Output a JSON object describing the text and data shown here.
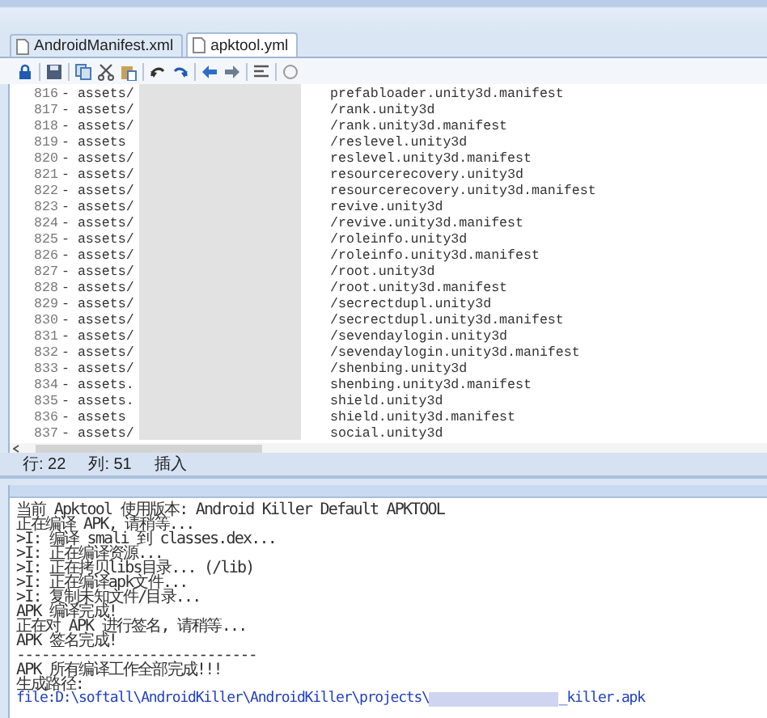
{
  "tabs": [
    {
      "label": "AndroidManifest.xml",
      "selected": false
    },
    {
      "label": "apktool.yml",
      "selected": true
    }
  ],
  "editor": {
    "lines": [
      {
        "number": "816",
        "prefix": "- assets/",
        "suffix": "prefabloader.unity3d.manifest"
      },
      {
        "number": "817",
        "prefix": "- assets/",
        "suffix": "/rank.unity3d"
      },
      {
        "number": "818",
        "prefix": "- assets/",
        "suffix": "/rank.unity3d.manifest"
      },
      {
        "number": "819",
        "prefix": "- assets",
        "suffix": "/reslevel.unity3d"
      },
      {
        "number": "820",
        "prefix": "- assets/",
        "suffix": "reslevel.unity3d.manifest"
      },
      {
        "number": "821",
        "prefix": "- assets/",
        "suffix": "resourcerecovery.unity3d"
      },
      {
        "number": "822",
        "prefix": "- assets/",
        "suffix": "resourcerecovery.unity3d.manifest"
      },
      {
        "number": "823",
        "prefix": "- assets/",
        "suffix": "revive.unity3d"
      },
      {
        "number": "824",
        "prefix": "- assets/",
        "suffix": "/revive.unity3d.manifest"
      },
      {
        "number": "825",
        "prefix": "- assets/",
        "suffix": "/roleinfo.unity3d"
      },
      {
        "number": "826",
        "prefix": "- assets/",
        "suffix": "/roleinfo.unity3d.manifest"
      },
      {
        "number": "827",
        "prefix": "- assets/",
        "suffix": "/root.unity3d"
      },
      {
        "number": "828",
        "prefix": "- assets/",
        "suffix": "/root.unity3d.manifest"
      },
      {
        "number": "829",
        "prefix": "- assets/",
        "suffix": "/secrectdupl.unity3d"
      },
      {
        "number": "830",
        "prefix": "- assets/",
        "suffix": "/secrectdupl.unity3d.manifest"
      },
      {
        "number": "831",
        "prefix": "- assets/",
        "suffix": "/sevendaylogin.unity3d"
      },
      {
        "number": "832",
        "prefix": "- assets/",
        "suffix": "/sevendaylogin.unity3d.manifest"
      },
      {
        "number": "833",
        "prefix": "- assets/",
        "suffix": "/shenbing.unity3d"
      },
      {
        "number": "834",
        "prefix": "- assets.",
        "suffix": "shenbing.unity3d.manifest"
      },
      {
        "number": "835",
        "prefix": "- assets.",
        "suffix": "shield.unity3d"
      },
      {
        "number": "836",
        "prefix": "- assets",
        "suffix": "shield.unity3d.manifest"
      },
      {
        "number": "837",
        "prefix": "- assets/",
        "suffix": "social.unity3d"
      }
    ]
  },
  "status_bar": [
    "行: 22",
    "列: 51",
    "插入"
  ],
  "output": {
    "lines": [
      "当前 Apktool 使用版本: Android Killer Default APKTOOL",
      "正在编译 APK, 请稍等...",
      ">I: 编译 smali 到 classes.dex...",
      ">I: 正在编译资源...",
      ">I: 正在拷贝libs目录... (/lib)",
      ">I: 正在编译apk文件...",
      ">I: 复制未知文件/目录...",
      "APK 编译完成!",
      "正在对 APK 进行签名, 请稍等...",
      "APK 签名完成!",
      "-----------------------------",
      "APK 所有编译工作全部完成!!!",
      "生成路径:"
    ],
    "path": {
      "prefix": "file:D:\\softall\\AndroidKiller\\AndroidKiller\\projects\\",
      "suffix": "_killer.apk"
    }
  }
}
